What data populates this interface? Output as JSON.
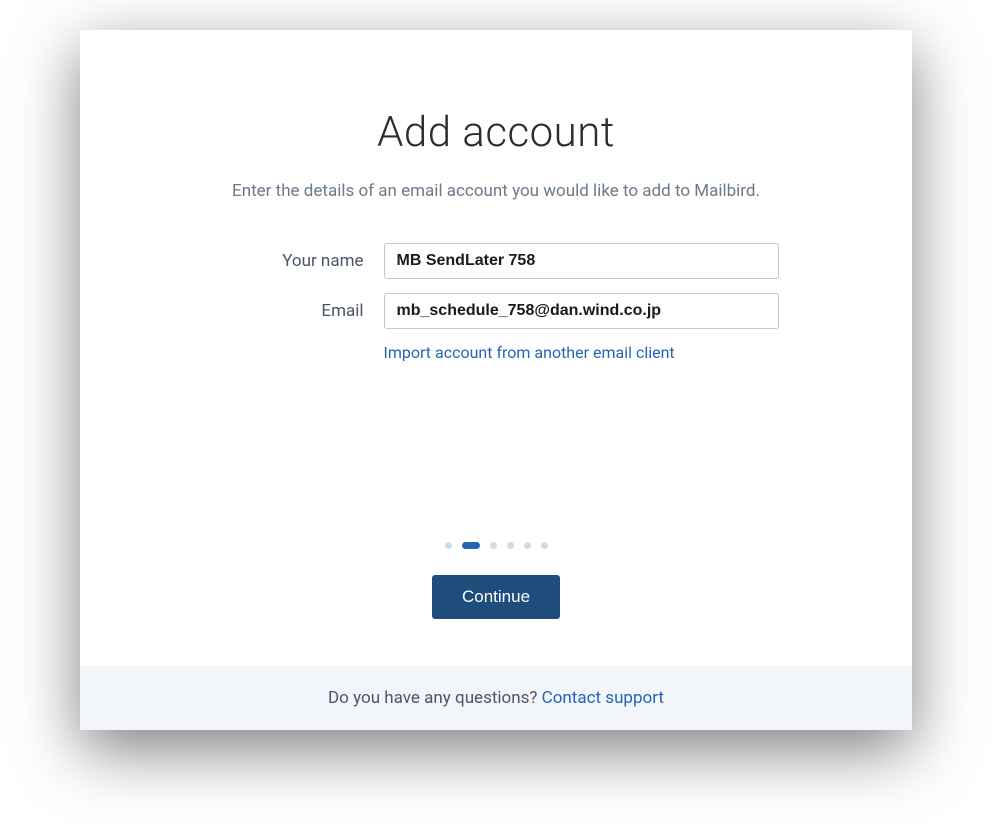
{
  "dialog": {
    "title": "Add account",
    "subtitle": "Enter the details of an email account you would like to add to Mailbird."
  },
  "form": {
    "name_label": "Your name",
    "name_value": "MB SendLater 758",
    "email_label": "Email",
    "email_value": "mb_schedule_758@dan.wind.co.jp",
    "import_link": "Import account from another email client"
  },
  "pagination": {
    "total": 6,
    "active_index": 1
  },
  "actions": {
    "continue": "Continue"
  },
  "footer": {
    "question": "Do you have any questions? ",
    "link": "Contact support"
  }
}
